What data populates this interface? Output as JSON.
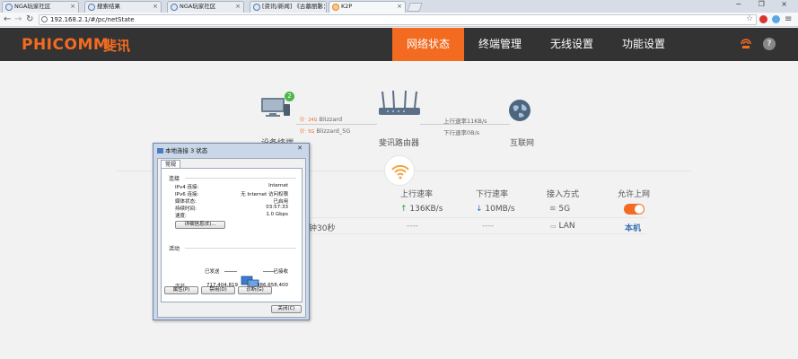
{
  "browser": {
    "tabs": [
      {
        "label": "NGA玩家社区"
      },
      {
        "label": "搜索结果"
      },
      {
        "label": "NGA玩家社区"
      },
      {
        "label": "[资讯/新闻] 《古墓丽影：暗影》..."
      },
      {
        "label": "K2P"
      }
    ],
    "url": "192.168.2.1/#/pc/netState",
    "window_controls": "− ❐ ×"
  },
  "header": {
    "brand": "PHICOMM",
    "brand_cn": "斐讯",
    "nav": [
      {
        "label": "网络状态",
        "active": true
      },
      {
        "label": "终端管理",
        "active": false
      },
      {
        "label": "无线设置",
        "active": false
      },
      {
        "label": "功能设置",
        "active": false
      }
    ],
    "help_label": "?"
  },
  "diagram": {
    "device_label": "设备终端",
    "device_badge": "2",
    "router_label": "斐讯路由器",
    "internet_label": "互联网",
    "wifi_24_tag": "24G",
    "wifi_24_name": "Blizzard",
    "wifi_5_tag": "5G",
    "wifi_5_name": "Blizzard_5G",
    "upload_rate": "上行速率11KB/s",
    "download_rate": "下行速率0B/s"
  },
  "table": {
    "headers": {
      "upload": "上行速率",
      "download": "下行速率",
      "access": "接入方式",
      "allow": "允许上网"
    },
    "rows": [
      {
        "duration": "",
        "upload": "136KB/s",
        "download": "10MB/s",
        "access": "5G",
        "allow": "toggle-on"
      },
      {
        "duration": "钟30秒",
        "upload": "----",
        "download": "----",
        "access": "LAN",
        "allow": "本机"
      }
    ]
  },
  "dialog": {
    "title": "本地连接 3 状态",
    "tab": "常规",
    "connection_section": "连接",
    "fields": [
      {
        "key": "IPv4 连接:",
        "value": "Internet"
      },
      {
        "key": "IPv6 连接:",
        "value": "无 Internet 访问权限"
      },
      {
        "key": "媒体状态:",
        "value": "已启用"
      },
      {
        "key": "持续时间:",
        "value": "03:57:33"
      },
      {
        "key": "速度:",
        "value": "1.0 Gbps"
      }
    ],
    "details_button": "详细信息(E)...",
    "activity_section": "活动",
    "sent_label": "已发送",
    "received_label": "已接收",
    "bytes_label": "字节:",
    "bytes_sent": "717,404,819",
    "bytes_received": "386,658,400",
    "buttons": {
      "properties": "属性(P)",
      "disable": "禁用(D)",
      "diagnose": "诊断(G)",
      "close": "关闭(C)"
    }
  },
  "colors": {
    "accent": "#f26b21",
    "header_bg": "#333333",
    "upload_arrow": "#2a9d3e",
    "download_arrow": "#2a6fd0"
  }
}
